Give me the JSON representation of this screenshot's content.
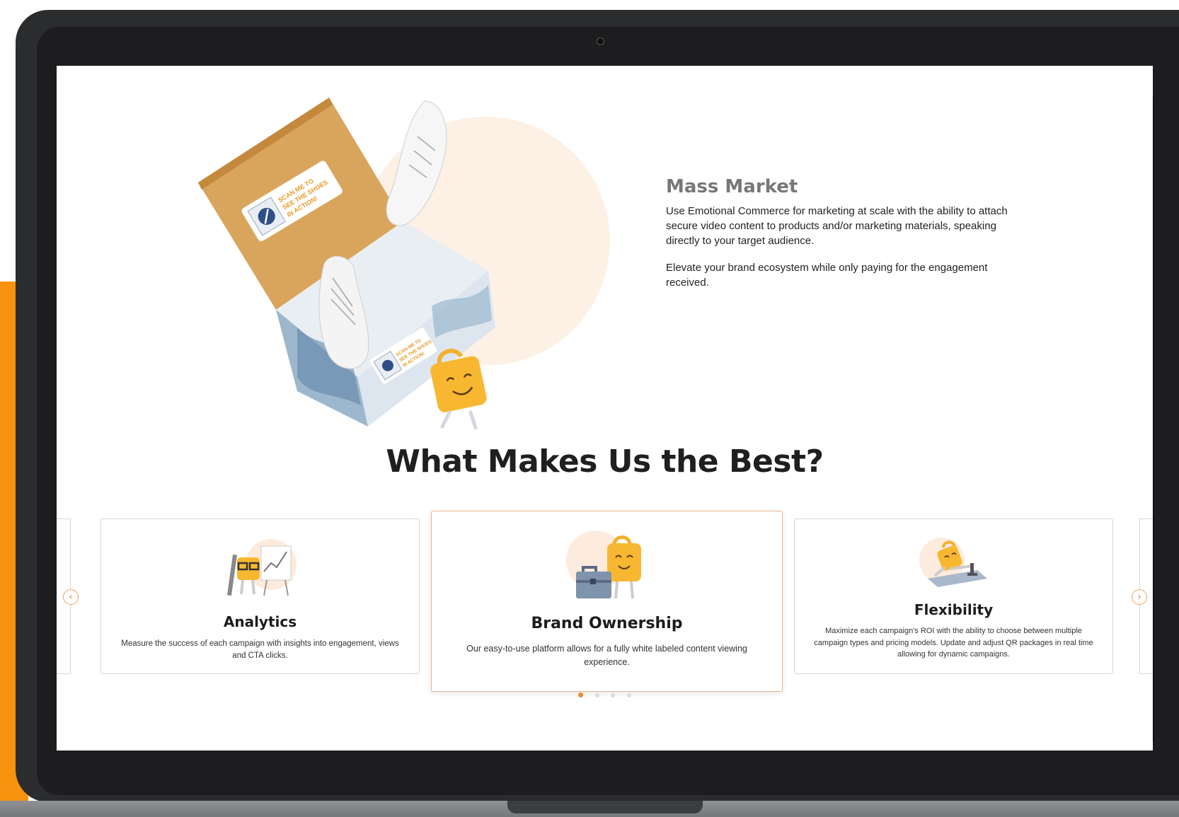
{
  "hero": {
    "box_label_large": "SCAN ME TO SEE THE SHOES IN ACTION!",
    "box_label_small": "SCAN ME TO SEE THE SHOES IN ACTION!",
    "title": "Mass Market",
    "paragraph1": "Use Emotional Commerce for marketing at scale with the ability to attach secure video content to products and/or marketing materials, speaking directly to your target audience.",
    "paragraph2": "Elevate your brand ecosystem while only paying for the engagement received."
  },
  "section": {
    "title": "What Makes Us the Best?"
  },
  "carousel": {
    "prev_label": "‹",
    "next_label": "›",
    "cards": [
      {
        "title": "Analytics",
        "description": "Measure the success of each campaign with insights into engagement, views and CTA clicks.",
        "icon": "analytics-icon"
      },
      {
        "title": "Brand Ownership",
        "description": "Our easy-to-use platform allows for a fully white labeled content viewing experience.",
        "icon": "briefcase-icon"
      },
      {
        "title": "Flexibility",
        "description": "Maximize each campaign's ROI with the ability to choose between multiple campaign types and pricing models. Update and adjust QR packages in real time allowing for dynamic campaigns.",
        "icon": "yoga-icon"
      }
    ],
    "page_count": 4,
    "active_page": 1
  },
  "colors": {
    "accent": "#F7930E",
    "frame": "#2b2c2e",
    "title_gray": "#777777"
  }
}
